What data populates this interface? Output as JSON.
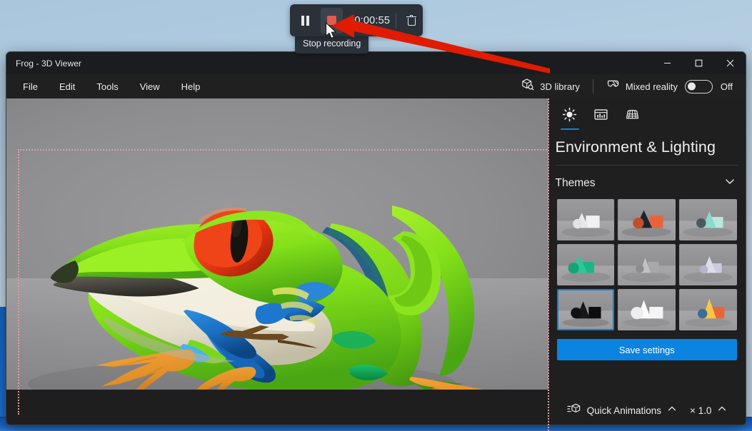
{
  "recorder": {
    "pause_icon": "pause-icon",
    "stop_icon": "stop-record-icon",
    "timer": "00:00:55",
    "delete_icon": "trash-icon",
    "tooltip": "Stop recording"
  },
  "window": {
    "title": "Frog - 3D Viewer",
    "controls": {
      "minimize": "minimize-icon",
      "maximize": "maximize-icon",
      "close": "close-icon"
    }
  },
  "menubar": {
    "items": [
      {
        "label": "File"
      },
      {
        "label": "Edit"
      },
      {
        "label": "Tools"
      },
      {
        "label": "View"
      },
      {
        "label": "Help"
      }
    ],
    "library": {
      "label": "3D library",
      "icon": "cube-search-icon"
    },
    "mixed_reality": {
      "label": "Mixed reality",
      "icon": "mixed-reality-icon",
      "state": "Off",
      "on": false
    }
  },
  "panel": {
    "tabs": [
      {
        "name": "lighting",
        "icon": "sun-icon",
        "active": true
      },
      {
        "name": "statistics",
        "icon": "panel-stats-icon",
        "active": false
      },
      {
        "name": "mesh-grid",
        "icon": "grid-icon",
        "active": false
      }
    ],
    "title": "Environment & Lighting",
    "section": {
      "label": "Themes",
      "chevron": "chevron-down-icon",
      "expanded": true
    },
    "themes": [
      {
        "id": 1,
        "name": "white-studio",
        "selected": false
      },
      {
        "id": 2,
        "name": "warm-sunset",
        "selected": false
      },
      {
        "id": 3,
        "name": "cool-mint",
        "selected": false
      },
      {
        "id": 4,
        "name": "green-forest",
        "selected": false
      },
      {
        "id": 5,
        "name": "soft-grey",
        "selected": false
      },
      {
        "id": 6,
        "name": "pale-lavender",
        "selected": false
      },
      {
        "id": 7,
        "name": "dark-contrast",
        "selected": true
      },
      {
        "id": 8,
        "name": "bright-white",
        "selected": false
      },
      {
        "id": 9,
        "name": "fire-orange",
        "selected": false
      }
    ],
    "save_label": "Save settings"
  },
  "animations": {
    "icon": "animation-cube-icon",
    "label": "Quick Animations",
    "chevron": "chevron-up-icon",
    "speed": "× 1.0",
    "speed_chevron": "chevron-up-icon"
  },
  "colors": {
    "accent": "#0a84e0",
    "record_red": "#e05c4f",
    "arrow_red": "#e01b00",
    "window_bg": "#1f1f1f",
    "titlebar_bg": "#1a1c1f",
    "desktop": "#b6cfe2",
    "rec_border": "#d99ba4"
  },
  "model": {
    "name": "frog-3d-model",
    "palette": {
      "body_green": "#7ede1a",
      "green_dark": "#13a44f",
      "belly_cream": "#ece7d6",
      "eye_red": "#e8381b",
      "pupil": "#17130f",
      "leg_blue": "#1a6fc4",
      "foot_orange": "#e5932a",
      "shadow_brown": "#6b4a22"
    }
  }
}
